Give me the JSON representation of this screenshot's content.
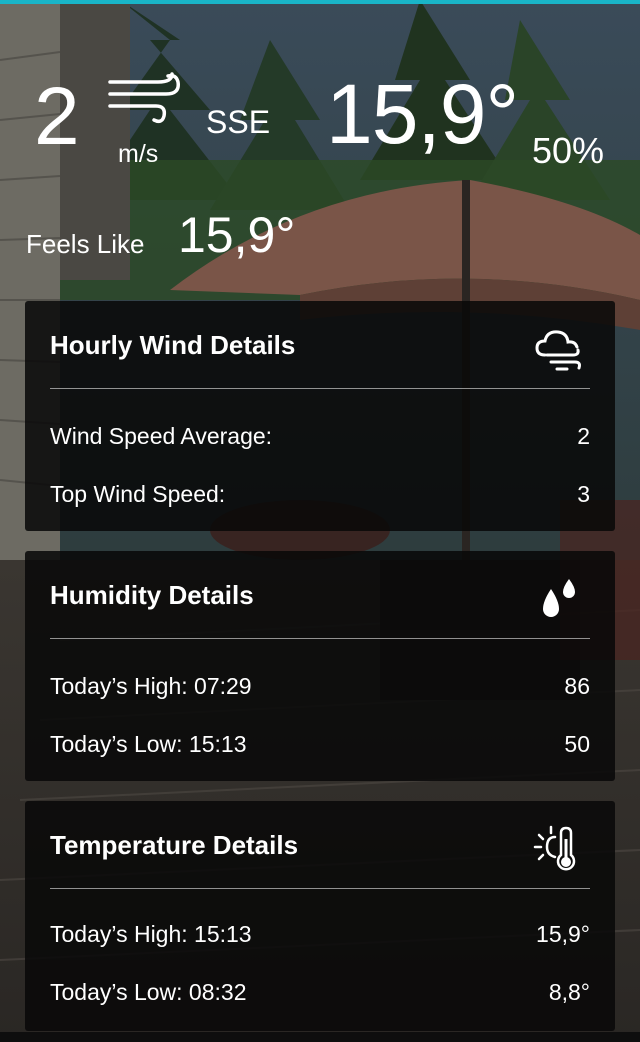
{
  "current": {
    "wind_speed": "2",
    "wind_unit": "m/s",
    "wind_direction": "SSE",
    "temperature": "15,9°",
    "humidity": "50%",
    "feels_like_label": "Feels Like",
    "feels_like_value": "15,9°"
  },
  "cards": {
    "wind": {
      "title": "Hourly Wind Details",
      "icon": "wind-cloud-icon",
      "rows": [
        {
          "label": "Wind Speed Average:",
          "value": "2"
        },
        {
          "label": "Top Wind Speed:",
          "value": "3"
        }
      ]
    },
    "humidity": {
      "title": "Humidity Details",
      "icon": "water-drops-icon",
      "rows": [
        {
          "label": "Today’s High: 07:29",
          "value": "86"
        },
        {
          "label": "Today’s Low: 15:13",
          "value": "50"
        }
      ]
    },
    "temperature": {
      "title": "Temperature Details",
      "icon": "thermometer-sun-icon",
      "rows": [
        {
          "label": "Today’s High: 15:13",
          "value": "15,9°"
        },
        {
          "label": "Today’s Low: 08:32",
          "value": "8,8°"
        }
      ]
    }
  },
  "colors": {
    "accent_bar": "#19b5c8",
    "card_background": "#080808"
  }
}
